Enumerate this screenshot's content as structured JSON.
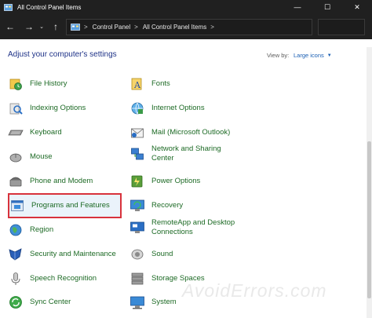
{
  "window": {
    "title": "All Control Panel Items",
    "controls": {
      "minimize": "—",
      "maximize": "☐",
      "close": "✕"
    }
  },
  "nav": {
    "back": "←",
    "forward": "→",
    "dropdown": "⌄",
    "up": "↑"
  },
  "breadcrumb": [
    {
      "label": "Control Panel"
    },
    {
      "label": "All Control Panel Items"
    }
  ],
  "breadcrumb_sep": ">",
  "heading": "Adjust your computer's settings",
  "view_by": {
    "label": "View by:",
    "value": "Large icons"
  },
  "items_left": [
    {
      "label": "File History",
      "icon": "file-history-icon"
    },
    {
      "label": "Indexing Options",
      "icon": "indexing-options-icon"
    },
    {
      "label": "Keyboard",
      "icon": "keyboard-icon"
    },
    {
      "label": "Mouse",
      "icon": "mouse-icon"
    },
    {
      "label": "Phone and Modem",
      "icon": "phone-modem-icon"
    },
    {
      "label": "Programs and Features",
      "icon": "programs-features-icon"
    },
    {
      "label": "Region",
      "icon": "region-icon"
    },
    {
      "label": "Security and Maintenance",
      "icon": "security-maintenance-icon"
    },
    {
      "label": "Speech Recognition",
      "icon": "microphone-icon"
    },
    {
      "label": "Sync Center",
      "icon": "sync-center-icon"
    }
  ],
  "items_right": [
    {
      "label": "Fonts",
      "icon": "fonts-icon"
    },
    {
      "label": "Internet Options",
      "icon": "internet-options-icon"
    },
    {
      "label": "Mail (Microsoft Outlook)",
      "icon": "mail-icon"
    },
    {
      "label_lines": [
        "Network and Sharing",
        "Center"
      ],
      "icon": "network-sharing-icon"
    },
    {
      "label": "Power Options",
      "icon": "power-options-icon"
    },
    {
      "label": "Recovery",
      "icon": "recovery-icon"
    },
    {
      "label_lines": [
        "RemoteApp and Desktop",
        "Connections"
      ],
      "icon": "remoteapp-icon"
    },
    {
      "label": "Sound",
      "icon": "speaker-icon"
    },
    {
      "label": "Storage Spaces",
      "icon": "storage-spaces-icon"
    },
    {
      "label": "System",
      "icon": "system-icon"
    }
  ],
  "watermark": "AvoidErrors.com",
  "colors": {
    "link": "#1d6a25",
    "heading": "#1e3287",
    "selection_border": "#d8323c",
    "titlebar": "#202020"
  }
}
